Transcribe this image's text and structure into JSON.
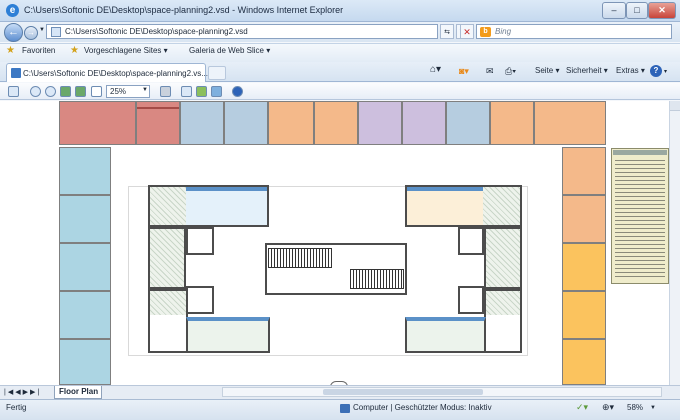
{
  "window": {
    "title": "C:\\Users\\Softonic DE\\Desktop\\space-planning2.vsd - Windows Internet Explorer",
    "buttons": [
      "–",
      "□",
      "✕"
    ]
  },
  "address": {
    "url": "C:\\Users\\Softonic DE\\Desktop\\space-planning2.vsd",
    "refresh": "↻",
    "stop": "✕",
    "search_placeholder": "Bing"
  },
  "favorites": {
    "label": "Favoriten",
    "suggested": "Vorgeschlagene Sites",
    "gallery": "Galeria de Web Slice"
  },
  "tab": {
    "title": "C:\\Users\\Softonic DE\\Desktop\\space-planning2.vs..."
  },
  "commandbar": {
    "page": "Seite",
    "security": "Sicherheit",
    "extras": "Extras",
    "help": "?"
  },
  "visio": {
    "zoom": "25%"
  },
  "sheet": {
    "tab_label": "Floor Plan"
  },
  "status": {
    "left": "Fertig",
    "zone": "Computer | Geschützter Modus: Inaktiv",
    "zoom": "58%"
  },
  "colors": {
    "red": "#d98882",
    "blue": "#b6cde0",
    "orange": "#f4b98a",
    "purple": "#cdbfde",
    "cyan": "#acd5e3",
    "gold": "#fbc35e",
    "accent": "#2d7fd6"
  }
}
